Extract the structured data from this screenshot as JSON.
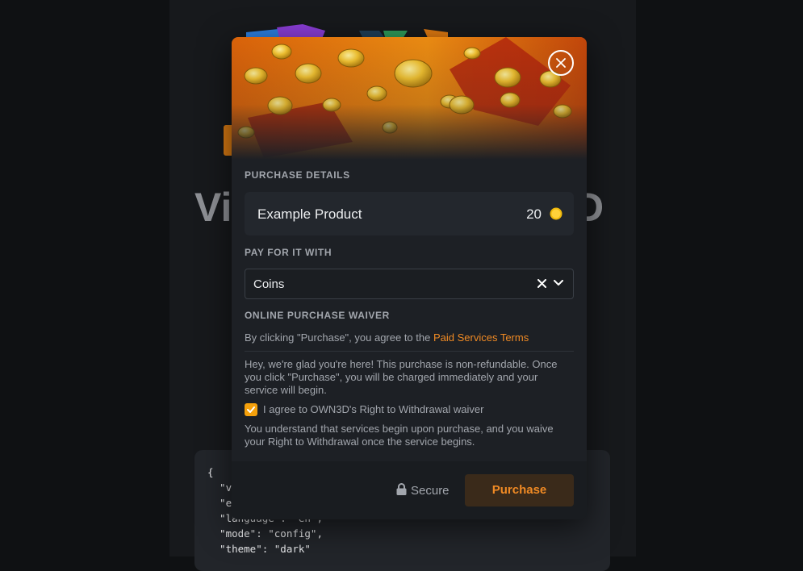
{
  "background": {
    "title_left": "Vi",
    "title_right": "D",
    "code_lines": [
      "{",
      "  \"v",
      "  \"e",
      "  \"language\": \"en\",",
      "  \"mode\": \"config\",",
      "  \"theme\": \"dark\""
    ]
  },
  "modal": {
    "close_icon": "close-icon",
    "purchase_details_label": "PURCHASE DETAILS",
    "product": {
      "name": "Example Product",
      "price": "20",
      "currency_icon": "coin-icon"
    },
    "pay_with_label": "PAY FOR IT WITH",
    "payment_select": {
      "value": "Coins",
      "clear_icon": "clear-icon",
      "dropdown_icon": "chevron-down-icon"
    },
    "waiver_label": "ONLINE PURCHASE WAIVER",
    "terms_prefix": "By clicking \"Purchase\", you agree to the ",
    "terms_link": "Paid Services Terms",
    "refund_notice": "Hey, we're glad you're here! This purchase is non-refundable. Once you click \"Purchase\", you will be charged immediately and your service will begin.",
    "waiver_checkbox": {
      "checked": true,
      "label": "I agree to OWN3D's Right to Withdrawal waiver"
    },
    "understand_notice": "You understand that services begin upon purchase, and you waive your Right to Withdrawal once the service begins.",
    "footer": {
      "secure_label": "Secure",
      "purchase_button": "Purchase"
    }
  },
  "colors": {
    "accent": "#f08a24",
    "checkbox": "#f5a10c",
    "modal_bg": "#1d2025",
    "page_bg": "#0f1113"
  }
}
